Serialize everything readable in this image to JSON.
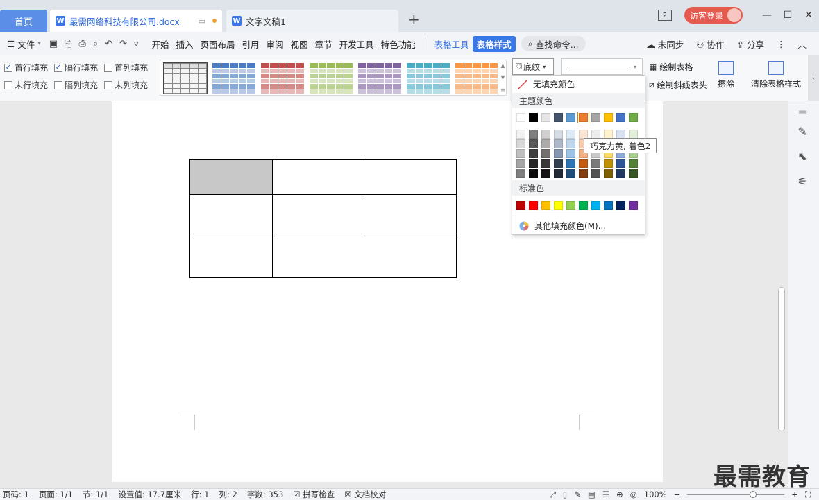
{
  "tabs": {
    "home": "首页",
    "doc1": "最需网络科技有限公司.docx",
    "doc2": "文字文稿1"
  },
  "titlebar": {
    "badge": "2",
    "login": "访客登录"
  },
  "menu": {
    "file": "文件",
    "items": [
      "开始",
      "插入",
      "页面布局",
      "引用",
      "审阅",
      "视图",
      "章节",
      "开发工具",
      "特色功能"
    ],
    "table_tools": "表格工具",
    "table_style": "表格样式",
    "search": "查找命令...",
    "unsync": "未同步",
    "collab": "协作",
    "share": "分享"
  },
  "ribbon": {
    "checks": [
      {
        "label": "首行填充",
        "checked": true
      },
      {
        "label": "隔行填充",
        "checked": true
      },
      {
        "label": "首列填充",
        "checked": false
      },
      {
        "label": "末行填充",
        "checked": false
      },
      {
        "label": "隔列填充",
        "checked": false
      },
      {
        "label": "末列填充",
        "checked": false
      }
    ],
    "shading": "底纹",
    "draw_table": "绘制表格",
    "draw_diag": "绘制斜线表头",
    "erase": "擦除",
    "clear_style": "清除表格样式",
    "gallery_colors": [
      "#555555",
      "#4a7cc4",
      "#c0504d",
      "#9bbb59",
      "#8064a2",
      "#4bacc6",
      "#f79646"
    ]
  },
  "dropdown": {
    "no_fill": "无填充颜色",
    "theme_colors": "主题颜色",
    "standard_colors": "标准色",
    "more": "其他填充颜色(M)...",
    "theme_row": [
      "#ffffff",
      "#000000",
      "#e7e6e6",
      "#44546a",
      "#5b9bd5",
      "#ed7d31",
      "#a5a5a5",
      "#ffc000",
      "#4472c4",
      "#70ad47"
    ],
    "selected_index": 5,
    "tint_rows": [
      [
        "#f2f2f2",
        "#7f7f7f",
        "#d0cece",
        "#d6dce4",
        "#deebf6",
        "#fbe5d5",
        "#ededed",
        "#fff2cc",
        "#d9e2f3",
        "#e2efd9"
      ],
      [
        "#d8d8d8",
        "#595959",
        "#aeaaaa",
        "#adb9ca",
        "#bdd7ee",
        "#f7cbac",
        "#dbdbdb",
        "#fee599",
        "#b4c6e7",
        "#c5e0b3"
      ],
      [
        "#bfbfbf",
        "#3f3f3f",
        "#757070",
        "#8496b0",
        "#9dc3e6",
        "#f4b183",
        "#c9c9c9",
        "#ffd965",
        "#8eaadb",
        "#a8d08d"
      ],
      [
        "#a5a5a5",
        "#262626",
        "#3a3838",
        "#323f4f",
        "#2e75b5",
        "#c55a11",
        "#7b7b7b",
        "#bf9000",
        "#2f5496",
        "#538135"
      ],
      [
        "#7f7f7f",
        "#0c0c0c",
        "#171616",
        "#222a35",
        "#1e4e79",
        "#833c0b",
        "#525252",
        "#7f6000",
        "#1f3864",
        "#375623"
      ]
    ],
    "standard_row": [
      "#c00000",
      "#ff0000",
      "#ffc000",
      "#ffff00",
      "#92d050",
      "#00b050",
      "#00b0f0",
      "#0070c0",
      "#002060",
      "#7030a0"
    ],
    "tooltip": "巧克力黄, 着色2"
  },
  "status": {
    "items": [
      "页码: 1",
      "页面: 1/1",
      "节: 1/1",
      "设置值: 17.7厘米",
      "行: 1",
      "列: 2",
      "字数: 353"
    ],
    "spell": "拼写检查",
    "proof": "文档校对",
    "zoom": "100%"
  },
  "watermark": "最需教育",
  "table": {
    "rows": 3,
    "cols": 3,
    "highlight_color": "#c8c8c8"
  }
}
